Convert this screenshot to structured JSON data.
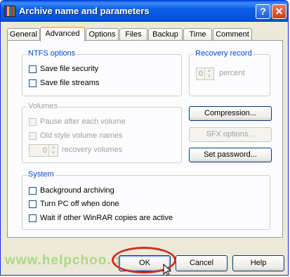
{
  "window": {
    "title": "Archive name and parameters"
  },
  "titlebar_buttons": {
    "help": "?",
    "close": "✕"
  },
  "tabs": [
    {
      "label": "General"
    },
    {
      "label": "Advanced"
    },
    {
      "label": "Options"
    },
    {
      "label": "Files"
    },
    {
      "label": "Backup"
    },
    {
      "label": "Time"
    },
    {
      "label": "Comment"
    }
  ],
  "active_tab": "Advanced",
  "ntfs": {
    "title": "NTFS options",
    "save_security": "Save file security",
    "save_streams": "Save file streams"
  },
  "recovery_record": {
    "title": "Recovery record",
    "value": "0",
    "unit": "percent"
  },
  "volumes": {
    "title": "Volumes",
    "pause": "Pause after each volume",
    "old_style": "Old style volume names",
    "recovery_value": "0",
    "recovery_label": "recovery volumes"
  },
  "buttons": {
    "compression": "Compression...",
    "sfx": "SFX options...",
    "password": "Set password..."
  },
  "system": {
    "title": "System",
    "background": "Background archiving",
    "turn_off": "Turn PC off when done",
    "wait": "Wait if other WinRAR copies are active"
  },
  "footer": {
    "ok": "OK",
    "cancel": "Cancel",
    "help": "Help"
  },
  "watermark": "www.helpchoo.com"
}
